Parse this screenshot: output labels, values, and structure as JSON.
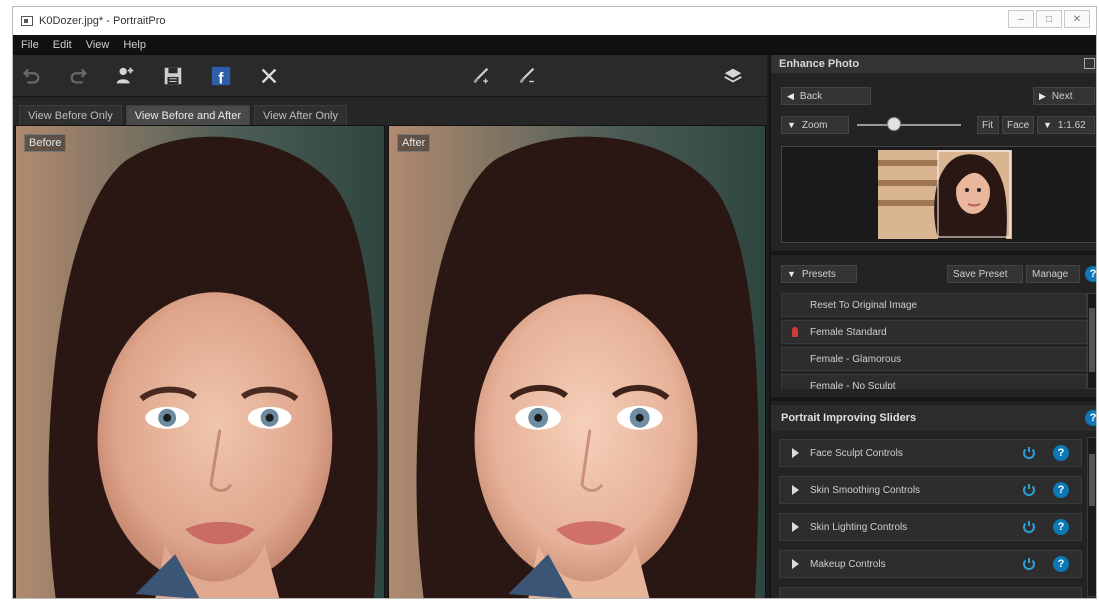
{
  "window": {
    "title": "K0Dozer.jpg* - PortraitPro",
    "controls": [
      "–",
      "□",
      "✕"
    ]
  },
  "menu": [
    "File",
    "Edit",
    "View",
    "Help"
  ],
  "toolbar": {
    "icons": [
      "undo-icon",
      "redo-icon",
      "add-person-icon",
      "save-icon",
      "facebook-icon",
      "close-icon",
      "brush-plus-icon",
      "brush-minus-icon",
      "layers-icon"
    ],
    "facebook_glyph": "f"
  },
  "view_tabs": [
    "View Before Only",
    "View Before and After",
    "View After Only"
  ],
  "view_tabs_active": 1,
  "panes": {
    "before_label": "Before",
    "after_label": "After"
  },
  "panel": {
    "title": "Enhance Photo",
    "back_label": "Back",
    "next_label": "Next",
    "zoom_label": "Zoom",
    "fit_label": "Fit",
    "face_label": "Face",
    "ratio_label": "1:1.62",
    "zoom_level": 0.3
  },
  "presets": {
    "header": "Presets",
    "save_label": "Save Preset",
    "manage_label": "Manage",
    "items": [
      {
        "label": "Reset To Original Image",
        "pinned": false
      },
      {
        "label": "Female Standard",
        "pinned": true
      },
      {
        "label": "Female - Glamorous",
        "pinned": false
      },
      {
        "label": "Female - No Sculpt",
        "pinned": false
      }
    ]
  },
  "sliders": {
    "header": "Portrait Improving Sliders",
    "groups": [
      "Face Sculpt Controls",
      "Skin Smoothing Controls",
      "Skin Lighting Controls",
      "Makeup Controls"
    ]
  },
  "colors": {
    "accent": "#0b79b6",
    "panel_bg": "#232323",
    "pin": "#d33b3b"
  }
}
